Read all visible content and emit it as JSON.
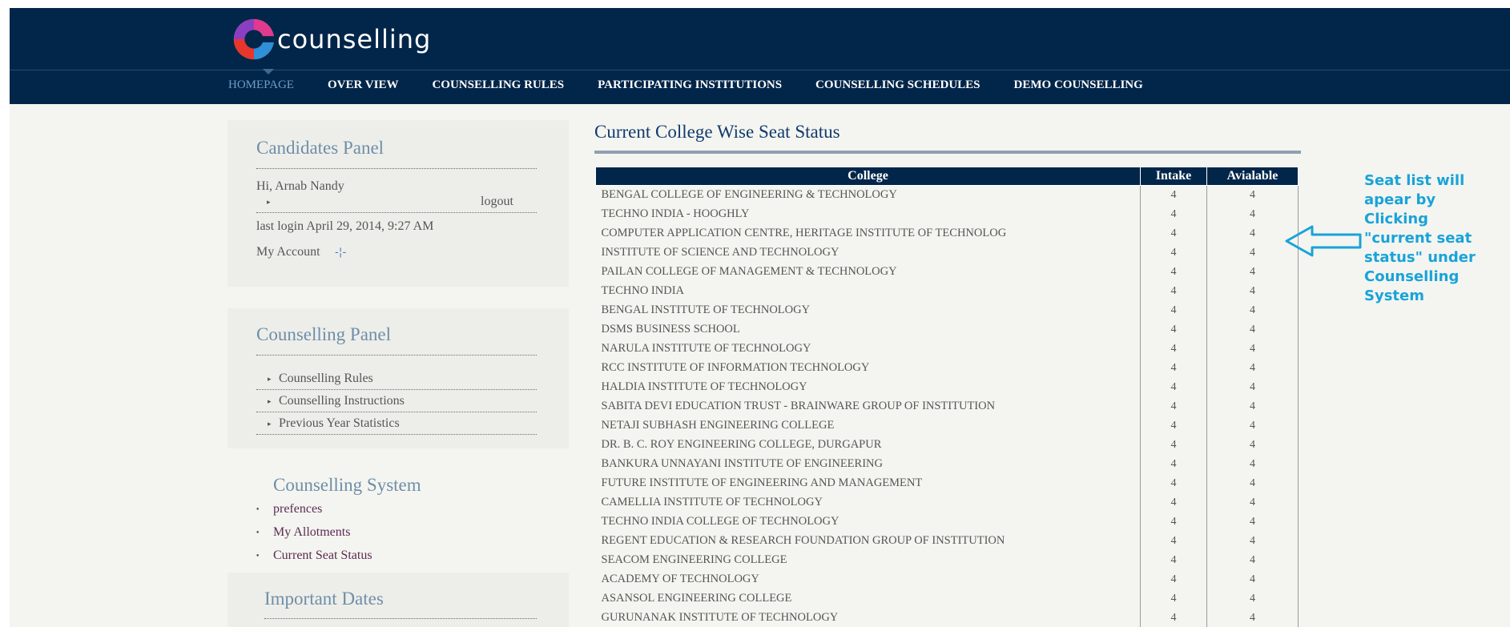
{
  "header": {
    "logo_text": "counselling",
    "nav": [
      {
        "label": "HOMEPAGE",
        "active": true
      },
      {
        "label": "OVER VIEW",
        "active": false
      },
      {
        "label": "COUNSELLING RULES",
        "active": false
      },
      {
        "label": "PARTICIPATING INSTITUTIONS",
        "active": false
      },
      {
        "label": "COUNSELLING SCHEDULES",
        "active": false
      },
      {
        "label": "DEMO COUNSELLING",
        "active": false
      }
    ]
  },
  "candidates_panel": {
    "title": "Candidates Panel",
    "greeting": "Hi,  Arnab Nandy",
    "logout": "logout",
    "last_login": "last login   April 29, 2014, 9:27 AM",
    "my_account": "My Account"
  },
  "counselling_panel": {
    "title": "Counselling Panel",
    "items": [
      "Counselling Rules",
      "Counselling Instructions",
      "Previous Year Statistics"
    ]
  },
  "counselling_system": {
    "title": "Counselling System",
    "items": [
      "prefences",
      "My Allotments",
      "Current Seat Status"
    ]
  },
  "important_dates": {
    "title": "Important Dates"
  },
  "main": {
    "title": "Current College Wise Seat Status",
    "columns": [
      "College",
      "Intake",
      "Avialable"
    ],
    "rows": [
      [
        "BENGAL COLLEGE OF ENGINEERING & TECHNOLOGY",
        "4",
        "4"
      ],
      [
        "TECHNO INDIA - HOOGHLY",
        "4",
        "4"
      ],
      [
        "COMPUTER APPLICATION CENTRE, HERITAGE INSTITUTE OF TECHNOLOG",
        "4",
        "4"
      ],
      [
        "INSTITUTE OF SCIENCE AND TECHNOLOGY",
        "4",
        "4"
      ],
      [
        "PAILAN COLLEGE OF MANAGEMENT & TECHNOLOGY",
        "4",
        "4"
      ],
      [
        "TECHNO INDIA",
        "4",
        "4"
      ],
      [
        "BENGAL INSTITUTE OF TECHNOLOGY",
        "4",
        "4"
      ],
      [
        "DSMS BUSINESS SCHOOL",
        "4",
        "4"
      ],
      [
        "NARULA INSTITUTE OF TECHNOLOGY",
        "4",
        "4"
      ],
      [
        "RCC INSTITUTE OF INFORMATION TECHNOLOGY",
        "4",
        "4"
      ],
      [
        "HALDIA INSTITUTE OF TECHNOLOGY",
        "4",
        "4"
      ],
      [
        "SABITA DEVI EDUCATION TRUST - BRAINWARE GROUP OF INSTITUTION",
        "4",
        "4"
      ],
      [
        "NETAJI SUBHASH ENGINEERING COLLEGE",
        "4",
        "4"
      ],
      [
        "DR. B. C. ROY ENGINEERING COLLEGE, DURGAPUR",
        "4",
        "4"
      ],
      [
        "BANKURA UNNAYANI INSTITUTE OF ENGINEERING",
        "4",
        "4"
      ],
      [
        "FUTURE INSTITUTE OF ENGINEERING AND MANAGEMENT",
        "4",
        "4"
      ],
      [
        "CAMELLIA INSTITUTE OF TECHNOLOGY",
        "4",
        "4"
      ],
      [
        "TECHNO INDIA COLLEGE OF TECHNOLOGY",
        "4",
        "4"
      ],
      [
        "REGENT EDUCATION & RESEARCH FOUNDATION GROUP OF INSTITUTION",
        "4",
        "4"
      ],
      [
        "SEACOM ENGINEERING COLLEGE",
        "4",
        "4"
      ],
      [
        "ACADEMY OF TECHNOLOGY",
        "4",
        "4"
      ],
      [
        "ASANSOL ENGINEERING COLLEGE",
        "4",
        "4"
      ],
      [
        "GURUNANAK INSTITUTE OF TECHNOLOGY",
        "4",
        "4"
      ]
    ]
  },
  "annotation": {
    "lines": [
      "Seat list will",
      "apear by",
      "Clicking",
      "\"current seat",
      "status\" under",
      "Counselling",
      "System"
    ],
    "color": "#19a3d9"
  },
  "colors": {
    "header_bg": "#02264a",
    "nav_active": "#6f9cc7",
    "panel_title": "#6f8ea7",
    "link": "#5a2a55"
  },
  "icons": [
    "logo-swirl-icon",
    "bullet-arrow-icon",
    "settings-sparkle-icon",
    "left-arrow-icon"
  ]
}
